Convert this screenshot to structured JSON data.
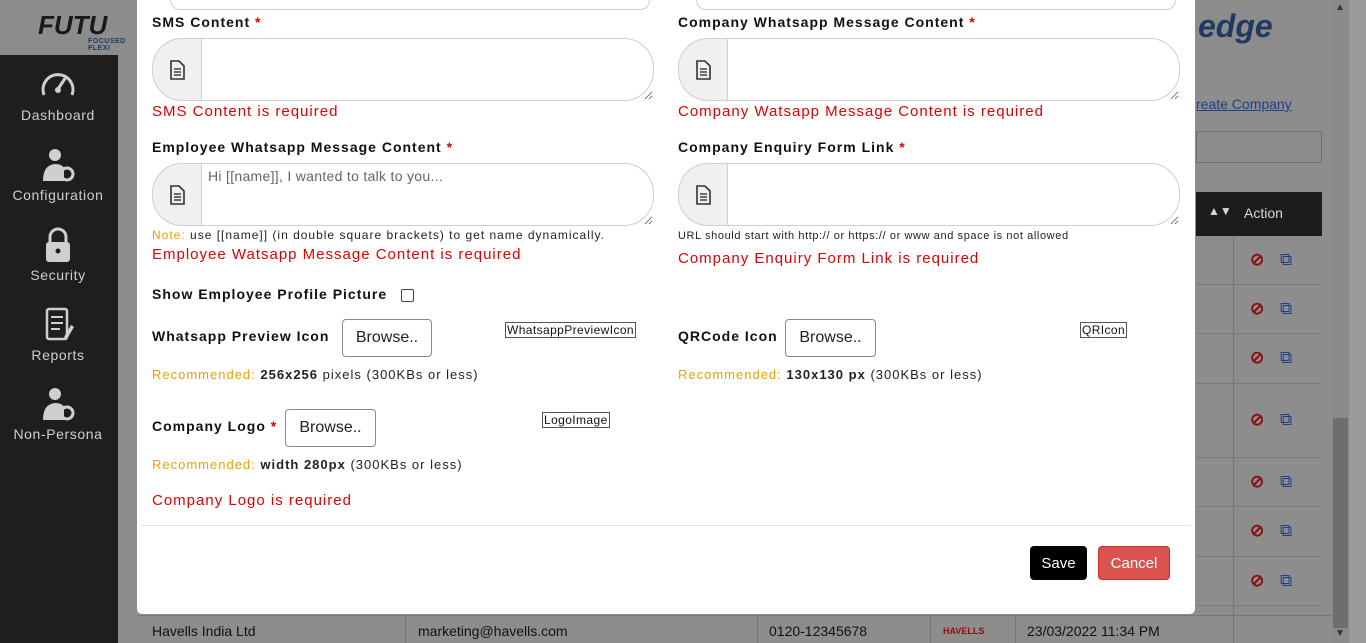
{
  "app": {
    "logo_left": "FUTU",
    "logo_left_tagline": "FOCUSED FLEXI",
    "logo_right": "edge"
  },
  "sidebar": {
    "items": [
      {
        "label": "Dashboard",
        "icon": "dashboard-gauge-icon"
      },
      {
        "label": "Configuration",
        "icon": "user-gear-icon"
      },
      {
        "label": "Security",
        "icon": "lock-icon"
      },
      {
        "label": "Reports",
        "icon": "report-document-icon"
      },
      {
        "label": "Non-Persona",
        "icon": "user-gear-icon"
      }
    ]
  },
  "background": {
    "create_link": "reate Company",
    "table_header_action": "Action",
    "last_row": {
      "company": "Havells India Ltd",
      "email": "marketing@havells.com",
      "phone": "0120-12345678",
      "logo_text": "HAVELLS",
      "created": "23/03/2022 11:34 PM"
    }
  },
  "modal": {
    "sms_content": {
      "label": "SMS Content",
      "required_mark": "*",
      "value": "",
      "placeholder": "",
      "error": "SMS Content is required"
    },
    "company_whatsapp_content": {
      "label": "Company Whatsapp Message Content",
      "required_mark": "*",
      "value": "",
      "placeholder": "",
      "error": "Company Watsapp Message Content is required"
    },
    "employee_whatsapp_content": {
      "label": "Employee Whatsapp Message Content",
      "required_mark": "*",
      "value": "",
      "placeholder": "Hi [[name]], I wanted to talk to you...",
      "note_key": "Note:",
      "note_text": "use [[name]] (in double square brackets) to get name dynamically.",
      "error": "Employee Watsapp Message Content is required"
    },
    "company_enquiry_link": {
      "label": "Company Enquiry Form Link",
      "required_mark": "*",
      "value": "",
      "placeholder": "",
      "hint": "URL should start with http:// or https:// or www and space is not allowed",
      "error": "Company Enquiry Form Link is required"
    },
    "show_profile_picture": {
      "label": "Show Employee Profile Picture",
      "checked": false
    },
    "whatsapp_preview_icon": {
      "label": "Whatsapp Preview Icon",
      "browse_label": "Browse..",
      "image_alt": "WhatsappPreviewIcon",
      "rec_key": "Recommended:",
      "rec_size": "256x256",
      "rec_rest": "pixels (300KBs or less)"
    },
    "qrcode_icon": {
      "label": "QRCode Icon",
      "browse_label": "Browse..",
      "image_alt": "QRIcon",
      "rec_key": "Recommended:",
      "rec_size": "130x130 px",
      "rec_rest": "(300KBs or less)"
    },
    "company_logo": {
      "label": "Company Logo",
      "required_mark": "*",
      "browse_label": "Browse..",
      "image_alt": "LogoImage",
      "rec_key": "Recommended:",
      "rec_size": "width 280px",
      "rec_rest": "(300KBs or less)",
      "error": "Company Logo is required"
    },
    "footer": {
      "save_label": "Save",
      "cancel_label": "Cancel"
    }
  },
  "colors": {
    "error": "#e00000",
    "recommended": "#f0a000",
    "save": "#000000",
    "cancel": "#d9534f",
    "sidebar": "#1e1e1e"
  }
}
